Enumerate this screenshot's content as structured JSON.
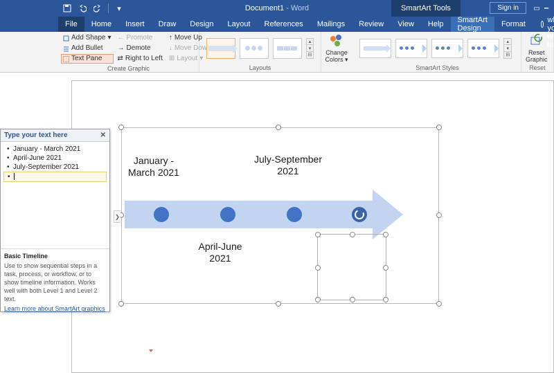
{
  "titlebar": {
    "document": "Document1",
    "app_sep": "  -  ",
    "app": "Word",
    "smartart_tools": "SmartArt Tools",
    "sign_in": "Sign in"
  },
  "tabs": {
    "file": "File",
    "home": "Home",
    "insert": "Insert",
    "draw": "Draw",
    "design": "Design",
    "layout": "Layout",
    "references": "References",
    "mailings": "Mailings",
    "review": "Review",
    "view": "View",
    "help": "Help",
    "smartart_design": "SmartArt Design",
    "format": "Format",
    "tell_me": "Tell me what you want to do"
  },
  "ribbon": {
    "create_graphic": {
      "label": "Create Graphic",
      "add_shape": "Add Shape",
      "add_bullet": "Add Bullet",
      "text_pane": "Text Pane",
      "promote": "Promote",
      "demote": "Demote",
      "right_to_left": "Right to Left",
      "move_up": "Move Up",
      "move_down": "Move Down",
      "layout_btn": "Layout"
    },
    "layouts": {
      "label": "Layouts"
    },
    "change_colors": {
      "label": "Change",
      "label2": "Colors"
    },
    "styles": {
      "label": "SmartArt Styles"
    },
    "reset": {
      "label": "Reset",
      "btn": "Reset",
      "btn2": "Graphic"
    }
  },
  "textpane": {
    "title": "Type your text here",
    "items": [
      "January - March 2021",
      "April-June 2021",
      "July-September 2021",
      ""
    ],
    "desc_title": "Basic Timeline",
    "desc_body": "Use to show sequential steps in a task, process, or workflow, or to show timeline information. Works well with both Level 1 and Level 2 text.",
    "link": "Learn more about SmartArt graphics"
  },
  "smartart": {
    "caption1": "January - March 2021",
    "caption2": "April-June 2021",
    "caption3": "July-September 2021"
  }
}
